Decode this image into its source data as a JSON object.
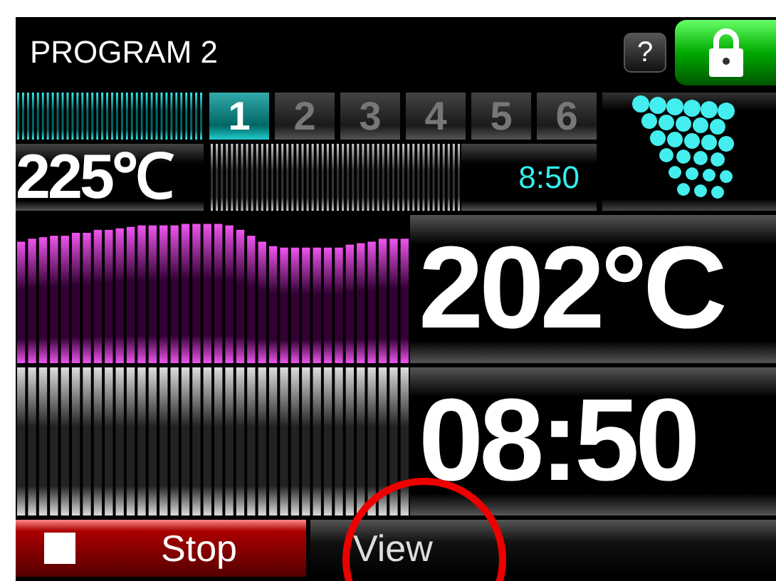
{
  "header": {
    "title": "PROGRAM 2",
    "help_button": "?"
  },
  "steps": [
    {
      "label": "1",
      "selected": true
    },
    {
      "label": "2",
      "selected": false
    },
    {
      "label": "3",
      "selected": false
    },
    {
      "label": "4",
      "selected": false
    },
    {
      "label": "5",
      "selected": false
    },
    {
      "label": "6",
      "selected": false
    }
  ],
  "setpoint": "225℃",
  "step_time": "8:50",
  "temperature": "202°C",
  "time_remaining": "08:50",
  "buttons": [
    {
      "label": "Stop",
      "kind": "stop"
    },
    {
      "label": "View",
      "kind": "view"
    }
  ]
}
